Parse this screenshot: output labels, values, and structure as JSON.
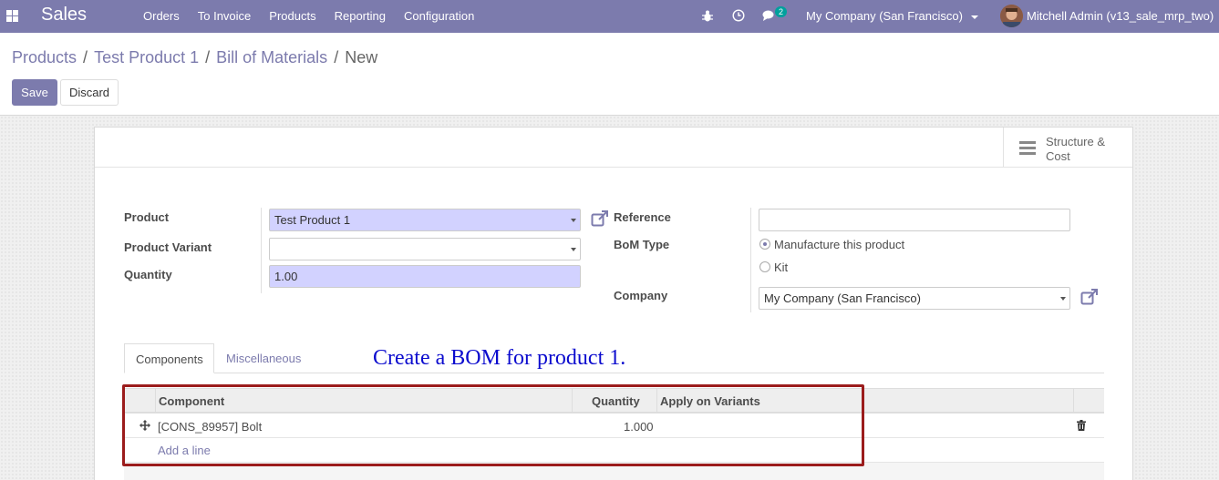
{
  "navbar": {
    "app_name": "Sales",
    "menu": [
      "Orders",
      "To Invoice",
      "Products",
      "Reporting",
      "Configuration"
    ],
    "chat_count": "2",
    "company": "My Company (San Francisco)",
    "user": "Mitchell Admin (v13_sale_mrp_two)"
  },
  "breadcrumb": {
    "items": [
      "Products",
      "Test Product 1",
      "Bill of Materials"
    ],
    "current": "New"
  },
  "buttons": {
    "save": "Save",
    "discard": "Discard"
  },
  "smart_button": {
    "label": "Structure & Cost"
  },
  "form": {
    "product_label": "Product",
    "product_value": "Test Product 1",
    "variant_label": "Product Variant",
    "variant_value": "",
    "quantity_label": "Quantity",
    "quantity_value": "1.00",
    "reference_label": "Reference",
    "reference_value": "",
    "bom_type_label": "BoM Type",
    "bom_type_options": [
      "Manufacture this product",
      "Kit"
    ],
    "bom_type_selected": "Manufacture this product",
    "company_label": "Company",
    "company_value": "My Company (San Francisco)"
  },
  "tabs": [
    "Components",
    "Miscellaneous"
  ],
  "annotation": "Create a BOM for product 1.",
  "table": {
    "headers": [
      "Component",
      "Quantity",
      "Apply on Variants"
    ],
    "rows": [
      {
        "component": "[CONS_89957] Bolt",
        "quantity": "1.000",
        "variants": ""
      }
    ],
    "add_line": "Add a line"
  },
  "colors": {
    "primary": "#7c7bad",
    "required_field": "#d2d2ff",
    "annotation_text": "#0b0bce",
    "highlight_border": "#9b1c1c"
  }
}
